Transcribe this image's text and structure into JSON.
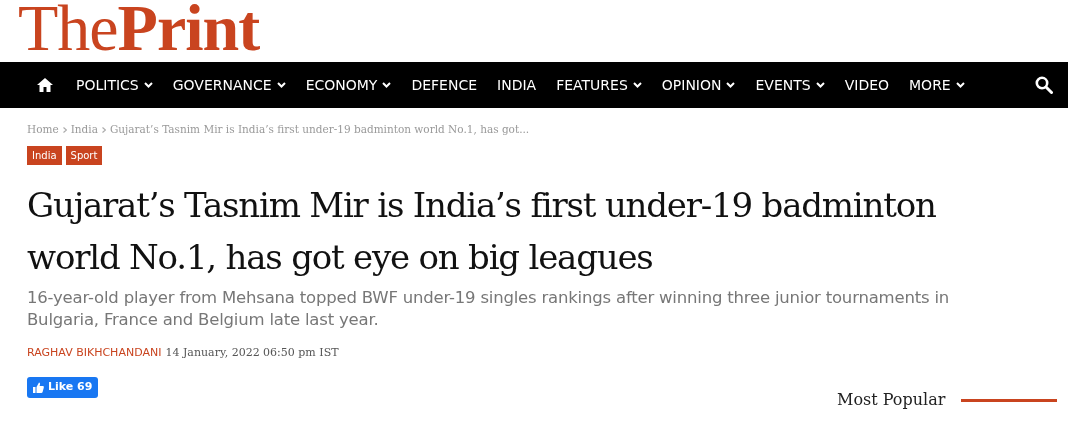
{
  "logo": "The**Print**",
  "nav": {
    "items": [
      {
        "label": "POLITICS",
        "dropdown": true
      },
      {
        "label": "GOVERNANCE",
        "dropdown": true
      },
      {
        "label": "ECONOMY",
        "dropdown": true
      },
      {
        "label": "DEFENCE",
        "dropdown": false
      },
      {
        "label": "INDIA",
        "dropdown": false
      },
      {
        "label": "FEATURES",
        "dropdown": true
      },
      {
        "label": "OPINION",
        "dropdown": true
      },
      {
        "label": "EVENTS",
        "dropdown": true
      },
      {
        "label": "VIDEO",
        "dropdown": false
      },
      {
        "label": "MORE",
        "dropdown": true
      }
    ]
  },
  "breadcrumb": [
    "Home",
    "India",
    "Gujarat’s Tasnim Mir is India’s first under-19 badminton world No.1, has got..."
  ],
  "tags": [
    "India",
    "Sport"
  ],
  "article": {
    "title": "Gujarat’s Tasnim Mir is India’s first under-19 badminton world No.1, has got eye on big leagues",
    "subtitle": "16-year-old player from Mehsana topped BWF under-19 singles rankings after winning three junior tournaments in Bulgaria, France and Belgium late last year.",
    "author": "RAGHAV BIKHCHANDANI",
    "date": "14 January, 2022 06:50 pm IST",
    "like": {
      "label": "Like",
      "count": "69"
    }
  },
  "sidebar": {
    "heading": "Most Popular"
  }
}
